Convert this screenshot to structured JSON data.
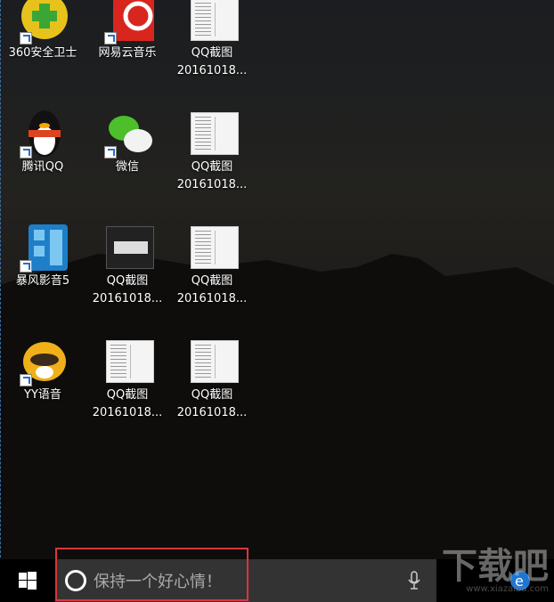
{
  "desktop": {
    "icons": [
      {
        "label": "360安全卫士",
        "type": "360"
      },
      {
        "label": "网易云音乐",
        "type": "netease"
      },
      {
        "label": "QQ截图20161018...",
        "l1": "QQ截图",
        "l2": "20161018...",
        "type": "thumb"
      },
      {
        "label": "腾讯QQ",
        "type": "qq"
      },
      {
        "label": "微信",
        "type": "wechat"
      },
      {
        "label": "QQ截图20161018...",
        "l1": "QQ截图",
        "l2": "20161018...",
        "type": "thumb"
      },
      {
        "label": "暴风影音5",
        "type": "baofeng"
      },
      {
        "label": "QQ截图20161018...",
        "l1": "QQ截图",
        "l2": "20161018...",
        "type": "thumb-dark"
      },
      {
        "label": "QQ截图20161018...",
        "l1": "QQ截图",
        "l2": "20161018...",
        "type": "thumb"
      },
      {
        "label": "YY语音",
        "type": "yy"
      },
      {
        "label": "QQ截图20161018...",
        "l1": "QQ截图",
        "l2": "20161018...",
        "type": "thumb"
      },
      {
        "label": "QQ截图20161018...",
        "l1": "QQ截图",
        "l2": "20161018...",
        "type": "thumb"
      }
    ]
  },
  "taskbar": {
    "search_placeholder": "保持一个好心情！",
    "highlight_color": "#d9373a"
  },
  "watermark": {
    "text": "下载吧",
    "url": "www.xiazaiba.com"
  }
}
